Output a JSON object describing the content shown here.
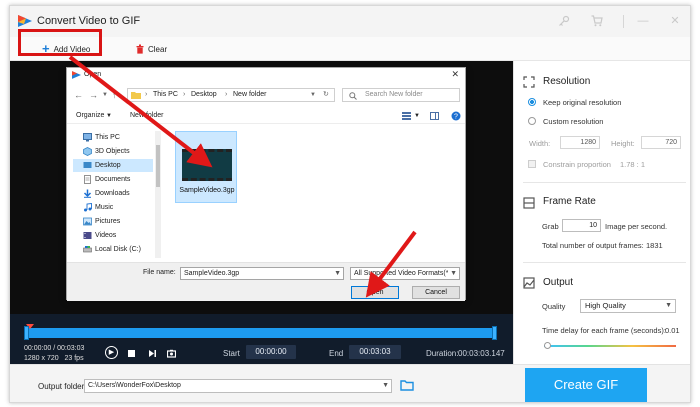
{
  "app": {
    "title": "Convert Video to GIF",
    "accent_color": "#1ea5f2",
    "title_icons": [
      "key-icon",
      "cart-icon",
      "minimize-icon",
      "close-icon"
    ],
    "close_glyph": "✕",
    "minimize_glyph": "—"
  },
  "toolbar": {
    "add_video_label": "Add Video",
    "clear_label": "Clear"
  },
  "player": {
    "current_time": "00:00:00",
    "separator": "/",
    "total_time": "00:03:03",
    "resolution": "1280 x 720",
    "fps": "23 fps",
    "start_label": "Start",
    "start_value": "00:00:00",
    "end_label": "End",
    "end_value": "00:03:03",
    "duration_label": "Duration:",
    "duration_value": "00:03:03.147"
  },
  "footer": {
    "output_folder_label": "Output folder:",
    "output_folder_value": "C:\\Users\\WonderFox\\Desktop",
    "create_gif_label": "Create GIF"
  },
  "resolution": {
    "title": "Resolution",
    "keep_original_label": "Keep original resolution",
    "custom_label": "Custom resolution",
    "keep_original_selected": true,
    "width_label": "Width:",
    "width_value": "1280",
    "height_label": "Height:",
    "height_value": "720",
    "constrain_label": "Constrain proportion",
    "constrain_ratio": "1.78 : 1"
  },
  "frame_rate": {
    "title": "Frame Rate",
    "grab_label": "Grab",
    "grab_value": "10",
    "per_second_label": "Image per second.",
    "total_frames_label": "Total number of output frames:",
    "total_frames_value": "1831"
  },
  "output": {
    "title": "Output",
    "quality_label": "Quality",
    "quality_value": "High Quality",
    "delay_label": "Time delay for each frame (seconds):",
    "delay_value": "0.01",
    "delay_slider_fraction": 0.02
  },
  "dialog": {
    "title": "Open",
    "breadcrumb": [
      "This PC",
      "Desktop",
      "New folder"
    ],
    "search_placeholder": "Search New folder",
    "organize_label": "Organize",
    "new_folder_label": "New folder",
    "tree": [
      {
        "label": "This PC",
        "icon": "computer-icon",
        "selected": false
      },
      {
        "label": "3D Objects",
        "icon": "cube-folder-icon",
        "selected": false
      },
      {
        "label": "Desktop",
        "icon": "desktop-folder-icon",
        "selected": true
      },
      {
        "label": "Documents",
        "icon": "documents-folder-icon",
        "selected": false
      },
      {
        "label": "Downloads",
        "icon": "downloads-folder-icon",
        "selected": false
      },
      {
        "label": "Music",
        "icon": "music-folder-icon",
        "selected": false
      },
      {
        "label": "Pictures",
        "icon": "pictures-folder-icon",
        "selected": false
      },
      {
        "label": "Videos",
        "icon": "videos-folder-icon",
        "selected": false
      },
      {
        "label": "Local Disk (C:)",
        "icon": "drive-icon",
        "selected": false
      }
    ],
    "file_name": "SampleVideo.3gp",
    "file_name_label": "File name:",
    "file_name_value": "SampleVideo.3gp",
    "file_type_value": "All Supported Video Formats(*.",
    "open_label": "Open",
    "cancel_label": "Cancel"
  }
}
